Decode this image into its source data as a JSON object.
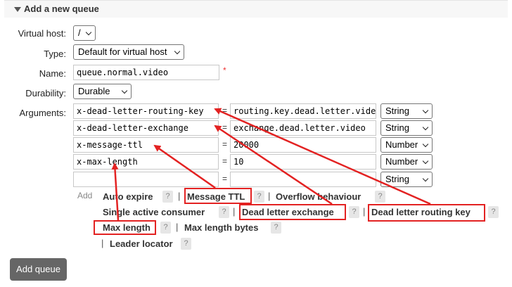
{
  "section": {
    "title": "Add a new queue"
  },
  "form": {
    "virtual_host": {
      "label": "Virtual host:",
      "value": "/"
    },
    "type": {
      "label": "Type:",
      "value": "Default for virtual host"
    },
    "name": {
      "label": "Name:",
      "value": "queue.normal.video",
      "required_mark": "*"
    },
    "durability": {
      "label": "Durability:",
      "value": "Durable"
    },
    "arguments": {
      "label": "Arguments:",
      "rows": [
        {
          "key": "x-dead-letter-routing-key",
          "eq": "=",
          "value": "routing.key.dead.letter.video",
          "type": "String"
        },
        {
          "key": "x-dead-letter-exchange",
          "eq": "=",
          "value": "exchange.dead.letter.video",
          "type": "String"
        },
        {
          "key": "x-message-ttl",
          "eq": "=",
          "value": "20000",
          "type": "Number"
        },
        {
          "key": "x-max-length",
          "eq": "=",
          "value": "10",
          "type": "Number"
        },
        {
          "key": "",
          "eq": "=",
          "value": "",
          "type": "String"
        }
      ]
    },
    "add_label": "Add",
    "hints": {
      "auto_expire": "Auto expire",
      "message_ttl": "Message TTL",
      "overflow_behaviour": "Overflow behaviour",
      "single_active_consumer": "Single active consumer",
      "dead_letter_exchange": "Dead letter exchange",
      "dead_letter_routing_key": "Dead letter routing key",
      "max_length": "Max length",
      "max_length_bytes": "Max length bytes",
      "leader_locator": "Leader locator",
      "help_mark": "?",
      "separator": "|"
    },
    "submit_label": "Add queue"
  },
  "colors": {
    "annotation": "#e32222",
    "button_bg": "#666666"
  }
}
